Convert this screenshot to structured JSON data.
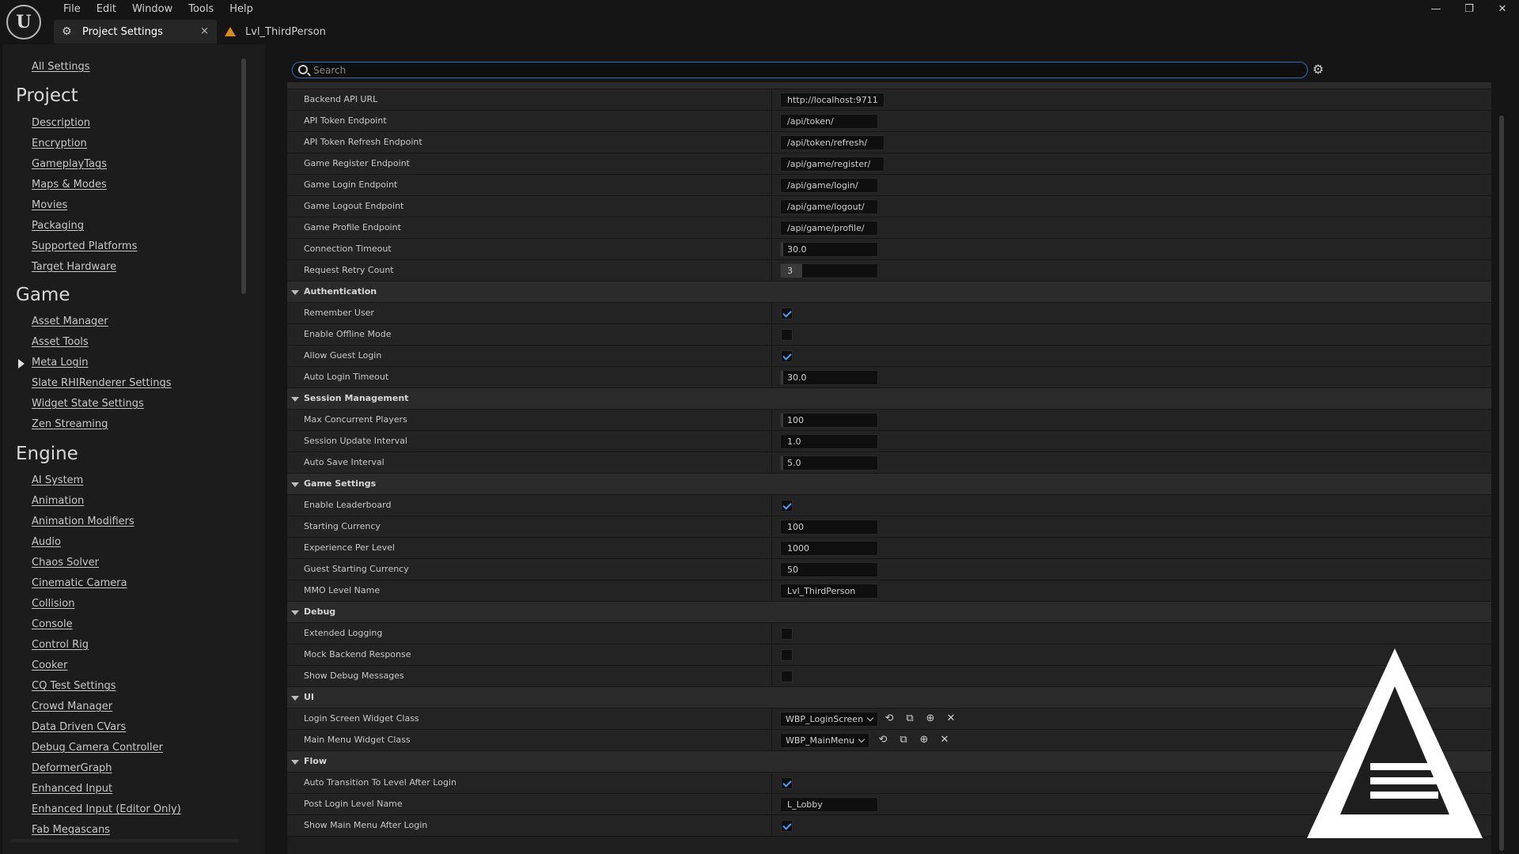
{
  "menu": [
    "File",
    "Edit",
    "Window",
    "Tools",
    "Help"
  ],
  "window_controls": {
    "minimize": "—",
    "restore": "❐",
    "close": "✕"
  },
  "tabs": {
    "active": {
      "label": "Project Settings",
      "icon": "settings-sliders-icon",
      "close": "×"
    },
    "level": {
      "label": "Lvl_ThirdPerson",
      "icon": "level-icon"
    }
  },
  "sidebar": {
    "all_settings": "All Settings",
    "sections": [
      {
        "title": "Project",
        "items": [
          "Description",
          "Encryption",
          "GameplayTags",
          "Maps & Modes",
          "Movies",
          "Packaging",
          "Supported Platforms",
          "Target Hardware"
        ]
      },
      {
        "title": "Game",
        "items": [
          "Asset Manager",
          "Asset Tools",
          "Meta Login",
          "Slate RHIRenderer Settings",
          "Widget State Settings",
          "Zen Streaming"
        ]
      },
      {
        "title": "Engine",
        "items": [
          "AI System",
          "Animation",
          "Animation Modifiers",
          "Audio",
          "Chaos Solver",
          "Cinematic Camera",
          "Collision",
          "Console",
          "Control Rig",
          "Cooker",
          "CQ Test Settings",
          "Crowd Manager",
          "Data Driven CVars",
          "Debug Camera Controller",
          "DeformerGraph",
          "Enhanced Input",
          "Enhanced Input (Editor Only)",
          "Fab Megascans"
        ]
      }
    ],
    "expanded_item": "Meta Login"
  },
  "search": {
    "placeholder": "Search",
    "value": ""
  },
  "settings_icon": "gear-icon",
  "properties": {
    "backend": [
      {
        "name": "Backend API URL",
        "type": "text",
        "value": "http://localhost:9711"
      },
      {
        "name": "API Token Endpoint",
        "type": "text",
        "value": "/api/token/"
      },
      {
        "name": "API Token Refresh Endpoint",
        "type": "text",
        "value": "/api/token/refresh/"
      },
      {
        "name": "Game Register Endpoint",
        "type": "text",
        "value": "/api/game/register/"
      },
      {
        "name": "Game Login Endpoint",
        "type": "text",
        "value": "/api/game/login/"
      },
      {
        "name": "Game Logout Endpoint",
        "type": "text",
        "value": "/api/game/logout/"
      },
      {
        "name": "Game Profile Endpoint",
        "type": "text",
        "value": "/api/game/profile/"
      },
      {
        "name": "Connection Timeout",
        "type": "num",
        "value": "30.0",
        "fill": 0.02
      },
      {
        "name": "Request Retry Count",
        "type": "num",
        "value": "3",
        "fill": 0.22
      }
    ],
    "categories": {
      "authentication": "Authentication",
      "session": "Session Management",
      "game": "Game Settings",
      "debug": "Debug",
      "ui": "UI",
      "flow": "Flow"
    },
    "authentication": [
      {
        "name": "Remember User",
        "type": "check",
        "checked": true
      },
      {
        "name": "Enable Offline Mode",
        "type": "check",
        "checked": false
      },
      {
        "name": "Allow Guest Login",
        "type": "check",
        "checked": true
      },
      {
        "name": "Auto Login Timeout",
        "type": "num",
        "value": "30.0",
        "fill": 0.02
      }
    ],
    "session": [
      {
        "name": "Max Concurrent Players",
        "type": "num",
        "value": "100",
        "fill": 0.01
      },
      {
        "name": "Session Update Interval",
        "type": "num",
        "value": "1.0",
        "fill": 0.0
      },
      {
        "name": "Auto Save Interval",
        "type": "num",
        "value": "5.0",
        "fill": 0.01
      }
    ],
    "game": [
      {
        "name": "Enable Leaderboard",
        "type": "check",
        "checked": true
      },
      {
        "name": "Starting Currency",
        "type": "num",
        "value": "100",
        "fill": 0.0
      },
      {
        "name": "Experience Per Level",
        "type": "num",
        "value": "1000",
        "fill": 0.0
      },
      {
        "name": "Guest Starting Currency",
        "type": "num",
        "value": "50",
        "fill": 0.0
      },
      {
        "name": "MMO Level Name",
        "type": "text",
        "value": "Lvl_ThirdPerson"
      }
    ],
    "debug": [
      {
        "name": "Extended Logging",
        "type": "check",
        "checked": false
      },
      {
        "name": "Mock Backend Response",
        "type": "check",
        "checked": false
      },
      {
        "name": "Show Debug Messages",
        "type": "check",
        "checked": false
      }
    ],
    "ui": [
      {
        "name": "Login Screen Widget Class",
        "type": "combo",
        "value": "WBP_LoginScreen"
      },
      {
        "name": "Main Menu Widget Class",
        "type": "combo",
        "value": "WBP_MainMenu"
      }
    ],
    "flow": [
      {
        "name": "Auto Transition To Level After Login",
        "type": "check",
        "checked": true
      },
      {
        "name": "Post Login Level Name",
        "type": "text",
        "value": "L_Lobby"
      },
      {
        "name": "Show Main Menu After Login",
        "type": "check",
        "checked": true
      }
    ]
  },
  "combo_icons": [
    "use-selected-icon",
    "browse-icon",
    "add-icon",
    "clear-icon"
  ],
  "colors": {
    "accent": "#4a9eff",
    "search_border": "#2e6db8",
    "level_icon": "#d78a1e"
  }
}
